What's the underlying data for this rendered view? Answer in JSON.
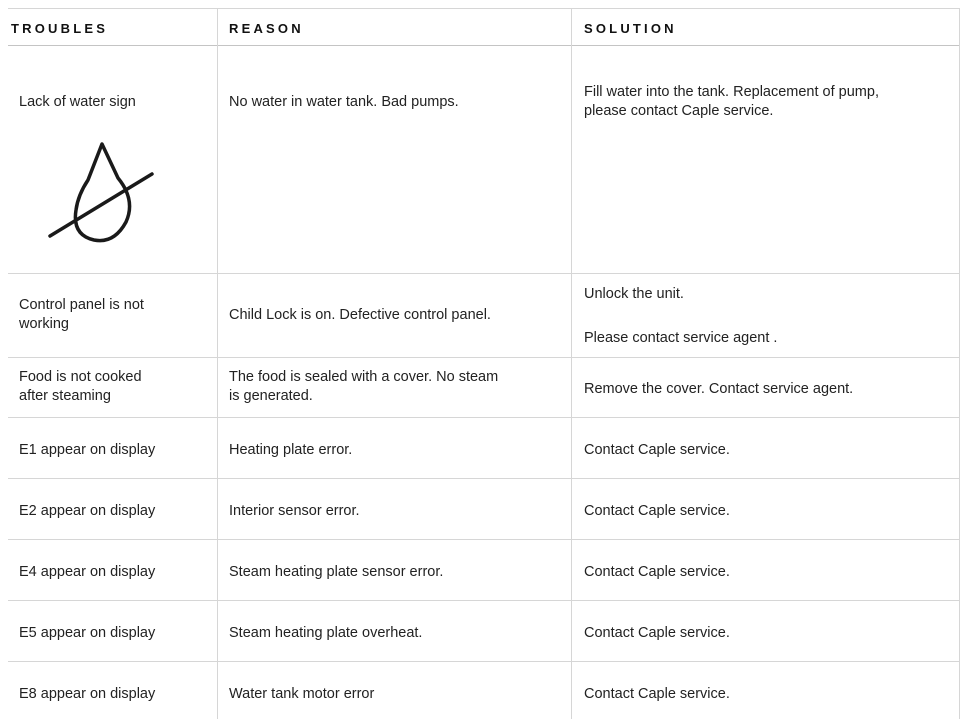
{
  "header": {
    "troubles": "TROUBLES",
    "reason": "REASON",
    "solution": "SOLUTION"
  },
  "rows": [
    {
      "trouble": "Lack of water sign",
      "reason": "No water in water tank. Bad pumps.",
      "solution_line1": "Fill water into the tank. Replacement of pump,",
      "solution_line2": "please contact Caple service.",
      "icon": "water-drop-crossed-icon"
    },
    {
      "trouble_line1": "Control panel is not",
      "trouble_line2": "working",
      "reason": "Child Lock is on. Defective control panel.",
      "solution_line1": "Unlock the unit.",
      "solution_line2": "Please contact service agent ."
    },
    {
      "trouble_line1": "Food is not cooked",
      "trouble_line2": "after steaming",
      "reason_line1": "The food is sealed with a cover. No steam",
      "reason_line2": "is generated.",
      "solution": "Remove the cover. Contact service agent."
    },
    {
      "trouble": "E1 appear on display",
      "reason": "Heating plate error.",
      "solution": "Contact Caple service."
    },
    {
      "trouble": "E2 appear on display",
      "reason": "Interior sensor error.",
      "solution": "Contact Caple service."
    },
    {
      "trouble": "E4 appear on display",
      "reason": "Steam heating plate sensor error.",
      "solution": "Contact Caple service."
    },
    {
      "trouble": "E5 appear on display",
      "reason": "Steam heating plate overheat.",
      "solution": "Contact Caple service."
    },
    {
      "trouble": "E8 appear on display",
      "reason": "Water tank motor error",
      "solution": "Contact Caple service."
    }
  ]
}
